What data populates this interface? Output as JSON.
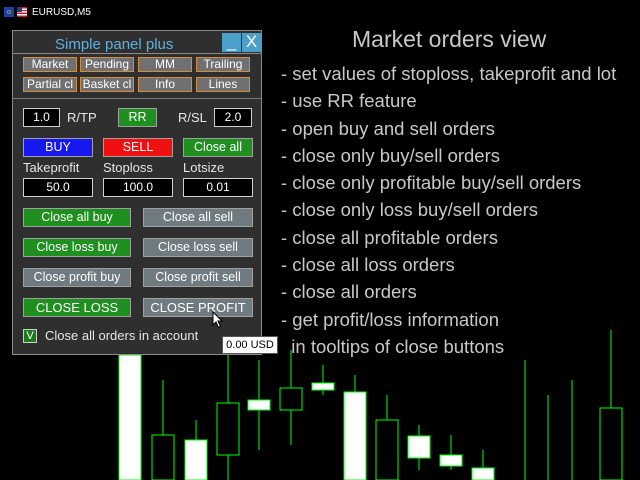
{
  "window": {
    "symbol": "EURUSD,M5",
    "flag_icons": [
      "eu-flag-icon",
      "us-flag-icon"
    ]
  },
  "description": {
    "title": "Market orders view",
    "items": [
      "- set values of stoploss, takeprofit and lot",
      "- use RR feature",
      "- open buy and sell orders",
      "- close only buy/sell orders",
      "- close only profitable buy/sell orders",
      "- close only loss buy/sell orders",
      "- close all profitable orders",
      "- close all loss orders",
      "- close all orders",
      "- get profit/loss information",
      "  in tooltips of close buttons"
    ]
  },
  "panel": {
    "title": "Simple panel plus",
    "minimize_label": "_",
    "close_label": "X",
    "tabs_row1": [
      "Market",
      "Pending",
      "MM",
      "Trailing"
    ],
    "tabs_row2": [
      "Partial cl",
      "Basket cl",
      "Info",
      "Lines"
    ],
    "rr_tp_value": "1.0",
    "rr_tp_label": "R/TP",
    "rr_button": "RR",
    "rr_sl_label": "R/SL",
    "rr_sl_value": "2.0",
    "buy_label": "BUY",
    "sell_label": "SELL",
    "close_all_label": "Close all",
    "takeprofit_label": "Takeprofit",
    "stoploss_label": "Stoploss",
    "lotsize_label": "Lotsize",
    "takeprofit_value": "50.0",
    "stoploss_value": "100.0",
    "lotsize_value": "0.01",
    "close_all_buy": "Close all buy",
    "close_all_sell": "Close all sell",
    "close_loss_buy": "Close loss buy",
    "close_loss_sell": "Close loss sell",
    "close_profit_buy": "Close profit buy",
    "close_profit_sell": "Close profit sell",
    "close_loss": "CLOSE LOSS",
    "close_profit": "CLOSE PROFIT",
    "checkbox_mark": "V",
    "checkbox_label": "Close all orders in account"
  },
  "tooltip": {
    "text": "0.00 USD"
  },
  "colors": {
    "bull_candle": "#ffffff",
    "candle_outline": "#00ff00",
    "panel_bg": "#2f2f2f",
    "title_blue": "#5fb0e0",
    "tab_border": "#d08f40"
  }
}
